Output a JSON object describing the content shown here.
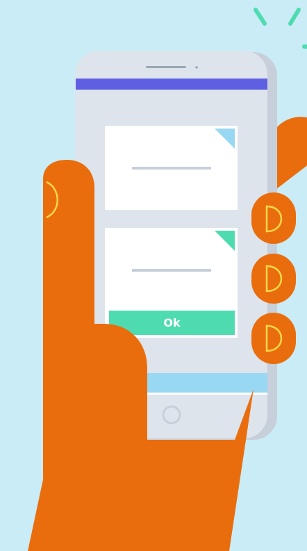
{
  "ok_button": {
    "label": "Ok"
  },
  "colors": {
    "background": "#c9ecf7",
    "hand": "#ea6d0d",
    "phone_body": "#dde4eb",
    "phone_shadow": "#c7d0da",
    "header_bar": "#5f5fe3",
    "card": "#ffffff",
    "accent_blue": "#98d8f2",
    "accent_green": "#4fdbb0",
    "fingernail": "#ffd84a"
  },
  "icons": [
    "sparkle-lines-icon",
    "home-button-icon",
    "card-corner-fold-icon"
  ]
}
